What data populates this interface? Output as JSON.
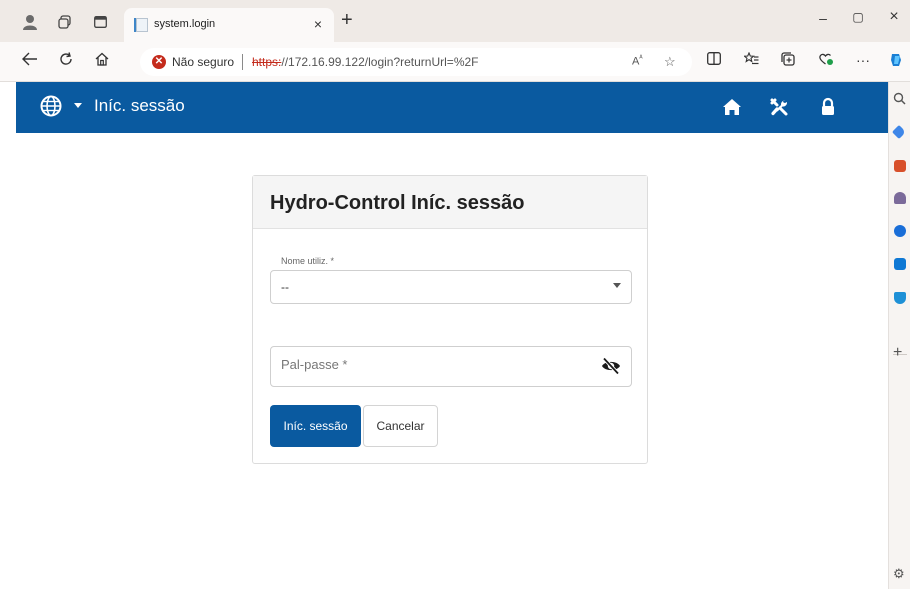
{
  "browser": {
    "tab_title": "system.login",
    "tab_close": "×",
    "new_tab": "+",
    "security_label": "Não seguro",
    "url_scheme": "https:",
    "url_rest": "//172.16.99.122/login?returnUrl=%2F",
    "window_controls": [
      "–",
      "▢",
      "×"
    ]
  },
  "app": {
    "header_title": "Iníc. sessão",
    "accent_color": "#0a5aa0"
  },
  "login": {
    "card_title": "Hydro-Control Iníc. sessão",
    "username_label": "Nome utiliz. *",
    "username_value": "--",
    "password_label": "Pal-passe *",
    "login_button": "Iníc. sessão",
    "cancel_button": "Cancelar"
  },
  "icons": {
    "header": [
      "globe-icon",
      "home-icon",
      "tools-icon",
      "lock-icon"
    ],
    "password_toggle": "eye-slash-icon"
  }
}
